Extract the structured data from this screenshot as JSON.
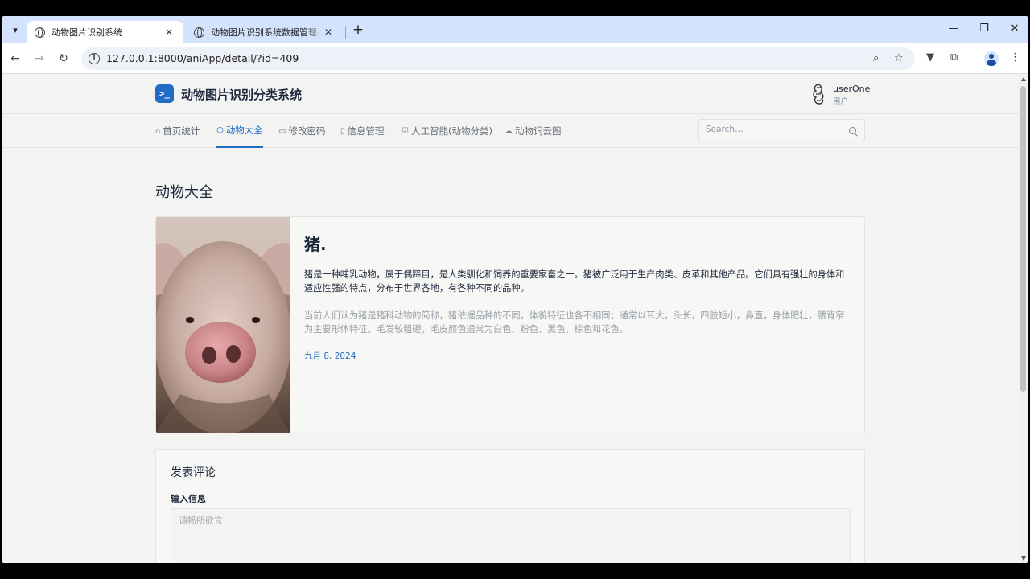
{
  "browser": {
    "tabs": [
      {
        "title": "动物图片识别系统",
        "active": true
      },
      {
        "title": "动物图片识别系统数据管理-登录",
        "active": false
      }
    ],
    "new_tab": "+",
    "url": "127.0.0.1:8000/aniApp/detail/?id=409"
  },
  "site": {
    "logo_glyph": ">_",
    "title": "动物图片识别分类系统",
    "user": {
      "name": "userOne",
      "role": "用户"
    }
  },
  "nav": {
    "items": [
      {
        "label": "首页统计",
        "icon": "home-icon"
      },
      {
        "label": "动物大全",
        "icon": "box-icon",
        "active": true
      },
      {
        "label": "修改密码",
        "icon": "calendar-icon"
      },
      {
        "label": "信息管理",
        "icon": "file-icon"
      },
      {
        "label": "人工智能(动物分类)",
        "icon": "checkbox-icon"
      },
      {
        "label": "动物词云图",
        "icon": "cloud-icon"
      }
    ],
    "search_placeholder": "Search…"
  },
  "main": {
    "heading": "动物大全",
    "animal": {
      "title": "猪.",
      "description": "猪是一种哺乳动物，属于偶蹄目，是人类驯化和饲养的重要家畜之一。猪被广泛用于生产肉类、皮革和其他产品。它们具有强壮的身体和适应性强的特点，分布于世界各地，有各种不同的品种。",
      "detail": "当前人们认为猪是猪科动物的简称，猪依据品种的不同，体貌特征也各不相同；通常以耳大，头长，四肢短小，鼻直，身体肥壮，腰背窄为主要形体特征。毛发较粗硬，毛皮颜色通常为白色、粉色、黑色、棕色和花色。",
      "date": "九月 8, 2024"
    },
    "comment": {
      "title": "发表评论",
      "label": "输入信息",
      "placeholder": "请畅所欲言"
    }
  },
  "colors": {
    "accent": "#206bc4",
    "tab_strip": "#d3e3fd",
    "page_bg": "#f3f4f2"
  }
}
